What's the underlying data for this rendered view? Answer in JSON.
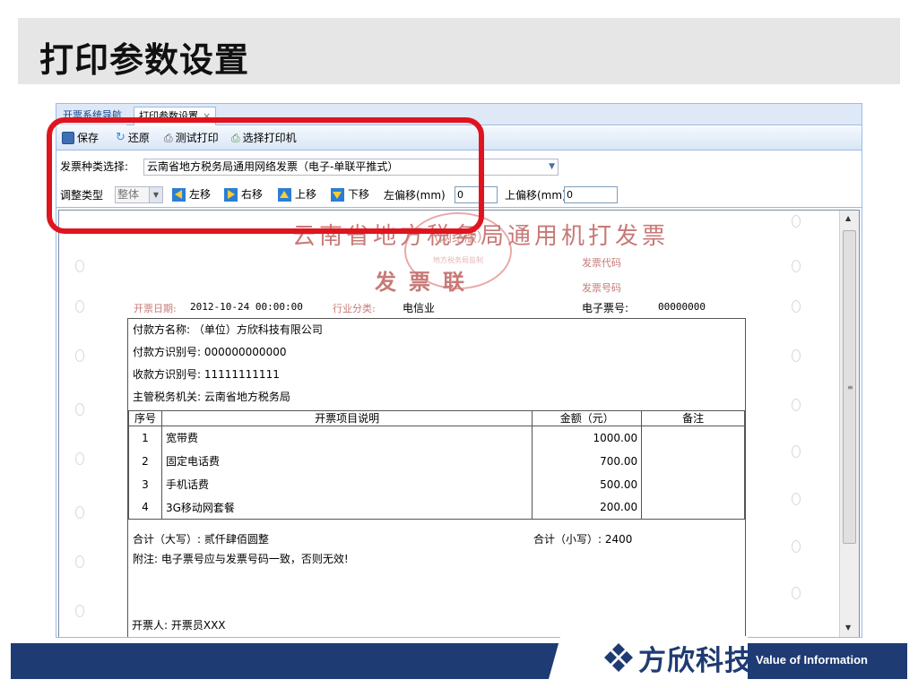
{
  "slide_title": "打印参数设置",
  "tabs": [
    {
      "label": "开票系统导航"
    },
    {
      "label": "打印参数设置",
      "close": "×"
    }
  ],
  "toolbar": {
    "save": "保存",
    "restore": "还原",
    "test_print": "测试打印",
    "select_printer": "选择打印机"
  },
  "invoice_type": {
    "label": "发票种类选择:",
    "value": "云南省地方税务局通用网络发票（电子-单联平推式）"
  },
  "adjust": {
    "type_label": "调整类型",
    "type_value": "整体",
    "left": "左移",
    "right": "右移",
    "up": "上移",
    "down": "下移",
    "left_offset_label": "左偏移(mm)",
    "left_offset_value": "0",
    "up_offset_label": "上偏移(mm)",
    "up_offset_value": "0"
  },
  "invoice": {
    "title": "云南省地方税务局通用机打发票",
    "stamp_sub": "（网络版）",
    "stamp_ring": "地方税务局监制",
    "subtitle": "发票联",
    "code_label": "发票代码",
    "number_label": "发票号码",
    "date_label": "开票日期:",
    "date_value": "2012-10-24 00:00:00",
    "industry_label": "行业分类:",
    "industry_value": "电信业",
    "e_number_label": "电子票号:",
    "e_number_value": "00000000",
    "payer": "付款方名称:   （单位）方欣科技有限公司",
    "payer_id": "付款方识别号: 000000000000",
    "payee_id": "收款方识别号: 11111111111",
    "authority": "主管税务机关: 云南省地方税务局",
    "columns": [
      "序号",
      "开票项目说明",
      "金额（元）",
      "备注"
    ],
    "items": [
      {
        "no": "1",
        "desc": "宽带费",
        "amount": "1000.00",
        "note": ""
      },
      {
        "no": "2",
        "desc": "固定电话费",
        "amount": "700.00",
        "note": ""
      },
      {
        "no": "3",
        "desc": "手机话费",
        "amount": "500.00",
        "note": ""
      },
      {
        "no": "4",
        "desc": "3G移动网套餐",
        "amount": "200.00",
        "note": ""
      }
    ],
    "total_upper": "合计（大写）: 贰仟肆佰圆整",
    "total_lower": "合计（小写）: 2400",
    "note": "附注: 电子票号应与发票号码一致，否则无效!",
    "issuer": "开票人:  开票员XXX"
  },
  "footer": {
    "logo_text": "方欣科技",
    "tagline": "Value of Information"
  },
  "colors": {
    "highlight_frame": "#e0141e",
    "footer_bar": "#1f3b73",
    "invoice_red": "#c77a77"
  }
}
